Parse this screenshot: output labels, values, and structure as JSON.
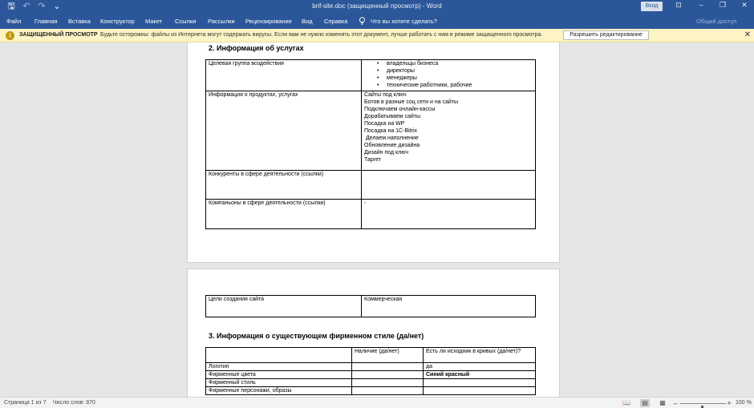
{
  "window": {
    "title": "brif-site.doc (защищенный просмотр) - Word",
    "signin_label": "Вход",
    "controls": {
      "restore_ribbon": "⊡",
      "minimize": "–",
      "maximize": "❐",
      "close": "✕"
    }
  },
  "qat": {
    "save": "🖫",
    "undo": "↶",
    "redo": "↷",
    "customize": "⌄"
  },
  "ribbon": {
    "tabs": [
      "Файл",
      "Главная",
      "Вставка",
      "Конструктор",
      "Макет",
      "Ссылки",
      "Рассылки",
      "Рецензирование",
      "Вид",
      "Справка"
    ],
    "tell_me": "Что вы хотите сделать?",
    "share": "Общий доступ"
  },
  "protected_view": {
    "icon": "i",
    "title": "ЗАЩИЩЕННЫЙ ПРОСМОТР",
    "message": "Будьте осторожны: файлы из Интернета могут содержать вирусы. Если вам не нужно изменять этот документ, лучше работать с ним в режиме защищенного просмотра.",
    "enable_editing": "Разрешить редактирование",
    "close": "✕"
  },
  "document": {
    "section2_heading": "2. Информация об услугах",
    "services_table": {
      "target_label": "Целевая группа воздействия",
      "target_items": [
        "владельцы бизнеса",
        "директоры",
        "менеджеры",
        "технические работники, рабочие"
      ],
      "products_label": "Информация о продуктах, услугах",
      "products_items": [
        "Сайты под ключ",
        "Ботов в разные соц сети и на сайты",
        "Подключаем онлайн-кассы",
        "Дорабатываем сайты",
        "Посадка на WP",
        "Посадка на 1С-Bitrix",
        " Делаем наполнение",
        "Обновление дизайна",
        "Дизайн под ключ",
        "Таргет"
      ],
      "competitors_label": "Конкуренты в сфере деятельности (ссылки)",
      "competitors_value": "",
      "partners_label": "Компаньоны в сфере деятельности (ссылки)",
      "partners_value": "-"
    },
    "goals_table": {
      "label": "Цели создания сайта",
      "value": "Коммерческая"
    },
    "section3_heading": "3. Информация о существующем фирменном стиле (да/нет)",
    "style_table": {
      "col_presence": "Наличие (да/нет)",
      "col_source": "Есть ли исходник в кривых (да/нет)?",
      "rows": [
        {
          "label": "Логотип",
          "presence": "",
          "source": "да"
        },
        {
          "label": "Фирменные цвета",
          "presence": "",
          "source": "Синий красный"
        },
        {
          "label": "Фирменный стиль",
          "presence": "",
          "source": ""
        },
        {
          "label": "Фирменные персонажи, образы",
          "presence": "",
          "source": ""
        }
      ]
    }
  },
  "status": {
    "page": "Страница 1 из 7",
    "words": "Число слов: 870",
    "zoom": "100 %",
    "zoom_minus": "–",
    "zoom_plus": "+",
    "view_icons": [
      "📖",
      "▤",
      "▦"
    ]
  }
}
